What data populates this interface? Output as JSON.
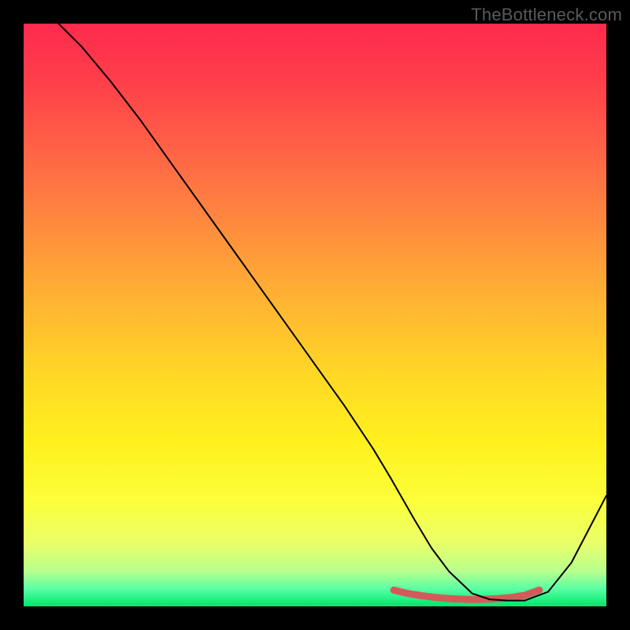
{
  "watermark": "TheBottleneck.com",
  "chart_data": {
    "type": "line",
    "title": "",
    "xlabel": "",
    "ylabel": "",
    "xlim": [
      0,
      100
    ],
    "ylim": [
      0,
      100
    ],
    "series": [
      {
        "name": "curve",
        "x": [
          6,
          10,
          15,
          20,
          25,
          30,
          35,
          40,
          45,
          50,
          55,
          60,
          63,
          67,
          70,
          73,
          77,
          80,
          83,
          86,
          90,
          94,
          100
        ],
        "y": [
          100,
          96,
          90,
          83.5,
          76.5,
          69.5,
          62.5,
          55.5,
          48.5,
          41.5,
          34.5,
          27,
          22,
          15,
          10,
          6,
          2.2,
          1.2,
          1.0,
          1.0,
          2.5,
          7.5,
          19
        ],
        "stroke": "#000000",
        "stroke_width": 2
      },
      {
        "name": "marker-band",
        "x": [
          63.5,
          66,
          68.5,
          71,
          73.5,
          76,
          78.5,
          81,
          83.5,
          86,
          88.5
        ],
        "y": [
          2.8,
          2.2,
          1.8,
          1.5,
          1.3,
          1.2,
          1.2,
          1.3,
          1.5,
          1.9,
          2.8
        ],
        "stroke": "#d45a5a",
        "stroke_width": 9
      }
    ]
  }
}
